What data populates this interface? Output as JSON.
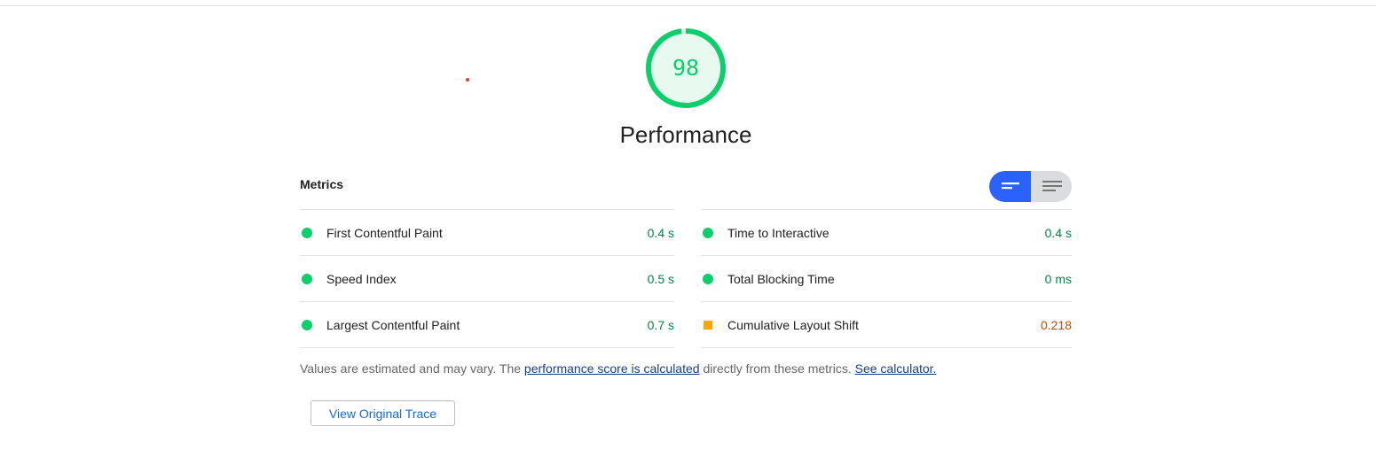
{
  "category": {
    "score": "98",
    "score_fraction": 0.98,
    "title": "Performance"
  },
  "metrics": {
    "header": "Metrics",
    "view_toggle": {
      "selected": "compact",
      "options": [
        "compact-view-icon",
        "expanded-view-icon"
      ]
    },
    "left": [
      {
        "label": "First Contentful Paint",
        "value": "0.4 s",
        "rating": "pass"
      },
      {
        "label": "Speed Index",
        "value": "0.5 s",
        "rating": "pass"
      },
      {
        "label": "Largest Contentful Paint",
        "value": "0.7 s",
        "rating": "pass"
      }
    ],
    "right": [
      {
        "label": "Time to Interactive",
        "value": "0.4 s",
        "rating": "pass"
      },
      {
        "label": "Total Blocking Time",
        "value": "0 ms",
        "rating": "pass"
      },
      {
        "label": "Cumulative Layout Shift",
        "value": "0.218",
        "rating": "average"
      }
    ]
  },
  "footnote": {
    "part1": "Values are estimated and may vary. The ",
    "link1": "performance score is calculated",
    "part2": " directly from these metrics. ",
    "link2": "See calculator."
  },
  "trace_button": "View Original Trace",
  "colors": {
    "pass": "#0cce6b",
    "pass_text": "#018642",
    "average": "#ffa400",
    "average_text": "#d04900",
    "toggle_active": "#2962ff",
    "link": "#1a3c8a",
    "button_text": "#1967d2"
  }
}
